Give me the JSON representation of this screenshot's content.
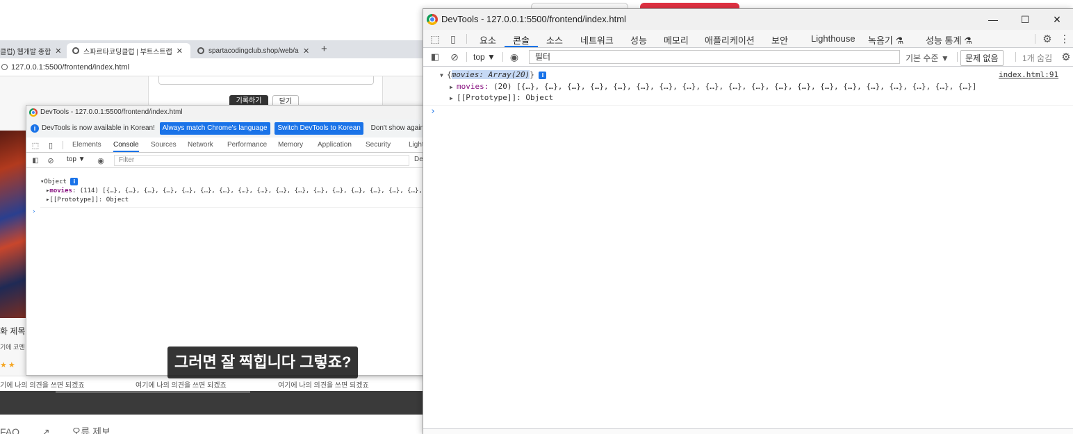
{
  "background": {
    "tabs": [
      {
        "label": "클럽) 웹개발 종합"
      },
      {
        "label": "스파르타코딩클럽 | 부트스트랩"
      },
      {
        "label": "spartacodingclub.shop/web/api"
      }
    ],
    "address": "127.0.0.1:5500/frontend/index.html",
    "form": {
      "save_label": "기록하기",
      "close_label": "닫기"
    },
    "movie": {
      "title": "화 제목",
      "subtitle": "기에 코멘",
      "stars": "★★"
    },
    "comments": [
      "기에 나의 의견을 쓰면 되겠죠",
      "여기에 나의 의견을 쓰면 되겠죠",
      "여기에 나의 의견을 쓰면 되겠죠"
    ],
    "footer": {
      "faq": "FAQ",
      "error_report": "오류 제보"
    }
  },
  "small_devtools": {
    "title": "DevTools - 127.0.0.1:5500/frontend/index.html",
    "banner": {
      "message": "DevTools is now available in Korean!",
      "btn_match": "Always match Chrome's language",
      "btn_switch": "Switch DevTools to Korean",
      "btn_dont": "Don't show again"
    },
    "tabs": [
      "Elements",
      "Console",
      "Sources",
      "Network",
      "Performance",
      "Memory",
      "Application",
      "Security",
      "Light"
    ],
    "context": "top ▼",
    "filter_placeholder": "Filter",
    "default_levels": "De",
    "console": {
      "object_label": "Object",
      "movies_key": "movies",
      "movies_value": "(114) [{…}, {…}, {…}, {…}, {…}, {…}, {…}, {…}, {…}, {…}, {…}, {…}, {…}, {…}, {…}, {…}, {…}, {…},",
      "proto": "[[Prototype]]: Object"
    }
  },
  "subtitle": "그러면 잘 찍힙니다 그렇죠?",
  "main_devtools": {
    "title": "DevTools - 127.0.0.1:5500/frontend/index.html",
    "window_buttons": {
      "minimize": "—",
      "maximize": "☐",
      "close": "✕"
    },
    "tabs": [
      "요소",
      "콘솔",
      "소스",
      "네트워크",
      "성능",
      "메모리",
      "애플리케이션",
      "보안",
      "Lighthouse",
      "녹음기 ⚗",
      "성능 통계 ⚗"
    ],
    "context": "top ▼",
    "filter_placeholder": "필터",
    "default_levels": "기본 수준 ▼",
    "issues": "문제 없음",
    "hidden": "1개 숨김",
    "console": {
      "summary": "movies: Array(20)",
      "source_link": "index.html:91",
      "movies_key": "movies:",
      "movies_value": "(20) [{…}, {…}, {…}, {…}, {…}, {…}, {…}, {…}, {…}, {…}, {…}, {…}, {…}, {…}, {…}, {…}, {…}, {…}, {…}, {…}]",
      "proto": "[[Prototype]]: Object"
    }
  }
}
